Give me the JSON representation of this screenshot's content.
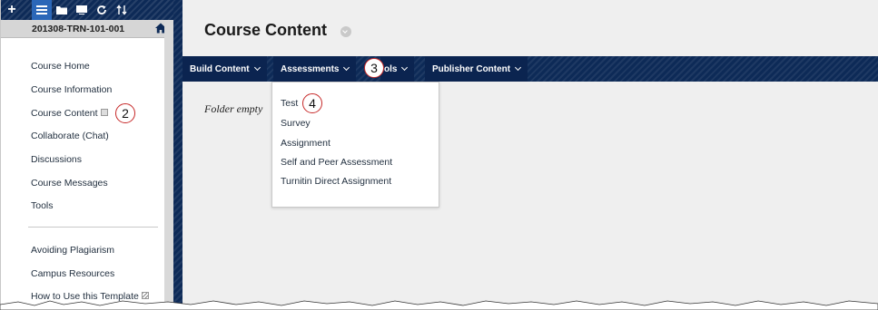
{
  "sidebar": {
    "course_id": "201308-TRN-101-001",
    "items": [
      {
        "label": "Course Home"
      },
      {
        "label": "Course Information"
      },
      {
        "label": "Course Content"
      },
      {
        "label": "Collaborate (Chat)"
      },
      {
        "label": "Discussions"
      },
      {
        "label": "Course Messages"
      },
      {
        "label": "Tools"
      },
      {
        "label": "Avoiding Plagiarism"
      },
      {
        "label": "Campus Resources"
      },
      {
        "label": "How to Use this Template"
      }
    ]
  },
  "main": {
    "page_title": "Course Content",
    "action_bar": [
      {
        "label": "Build Content"
      },
      {
        "label": "Assessments"
      },
      {
        "label": "ols"
      },
      {
        "label": "Publisher Content"
      }
    ],
    "empty_message": "Folder empty",
    "assessments_menu": [
      "Test",
      "Survey",
      "Assignment",
      "Self and Peer Assessment",
      "Turnitin Direct Assignment"
    ]
  },
  "callouts": {
    "course_content": "2",
    "assessments": "3",
    "test": "4"
  },
  "colors": {
    "nav_dark": "#0d2a57",
    "toolbar_active": "#2b67b8",
    "callout_ring": "#c62828",
    "content_bg": "#efefef"
  },
  "icons": [
    "plus-icon",
    "list-view-icon",
    "folder-view-icon",
    "display-view-icon",
    "refresh-icon",
    "reorder-icon",
    "home-icon"
  ]
}
